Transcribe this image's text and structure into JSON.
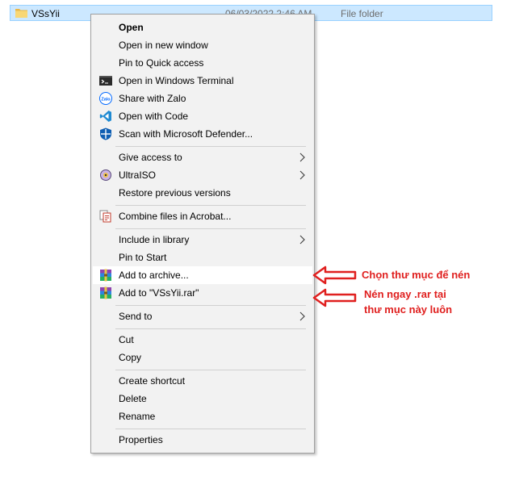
{
  "file": {
    "name": "VSsYii",
    "date": "06/03/2022 2:46 AM",
    "type": "File folder"
  },
  "menu": {
    "open": "Open",
    "open_new_window": "Open in new window",
    "pin_quick_access": "Pin to Quick access",
    "open_terminal": "Open in Windows Terminal",
    "share_zalo": "Share with Zalo",
    "open_code": "Open with Code",
    "scan_defender": "Scan with Microsoft Defender...",
    "give_access": "Give access to",
    "ultraiso": "UltraISO",
    "restore_versions": "Restore previous versions",
    "combine_acrobat": "Combine files in Acrobat...",
    "include_library": "Include in library",
    "pin_start": "Pin to Start",
    "add_archive": "Add to archive...",
    "add_rar": "Add to \"VSsYii.rar\"",
    "send_to": "Send to",
    "cut": "Cut",
    "copy": "Copy",
    "create_shortcut": "Create shortcut",
    "delete": "Delete",
    "rename": "Rename",
    "properties": "Properties"
  },
  "annotations": {
    "choose_folder": "Chọn thư mục để nén",
    "compress_line1": "Nén ngay .rar tại",
    "compress_line2": "thư mục này luôn",
    "color": "#e0201f"
  },
  "icons": {
    "folder": "folder-icon",
    "terminal": "terminal-icon",
    "zalo": "zalo-icon",
    "vscode": "vscode-icon",
    "defender": "defender-shield-icon",
    "ultraiso": "ultraiso-disc-icon",
    "acrobat": "acrobat-combine-icon",
    "winrar": "winrar-icon",
    "chevron": "chevron-right-icon"
  }
}
